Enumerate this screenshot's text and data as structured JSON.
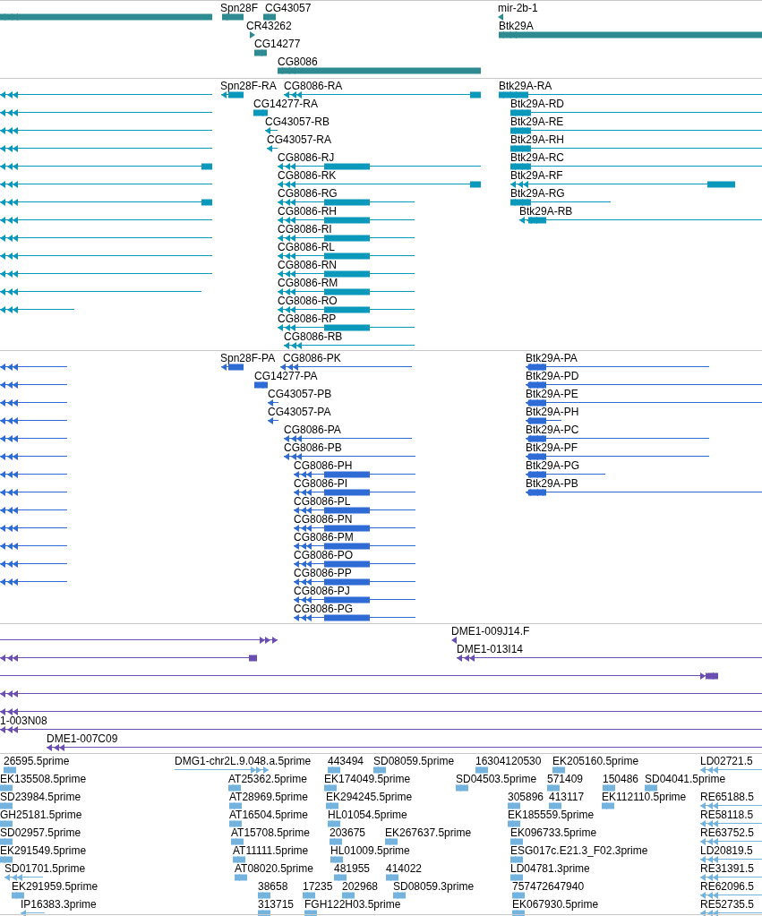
{
  "tracks": [
    {
      "color": "#2d8b91",
      "features": [
        {
          "label": "Spn28F"
        },
        {
          "label": "CG43057"
        },
        {
          "label": "mir-2b-1"
        },
        {
          "label": "CR43262"
        },
        {
          "label": "Btk29A"
        },
        {
          "label": "CG14277"
        },
        {
          "label": "CG8086"
        }
      ]
    },
    {
      "color": "#0a98bb",
      "features": [
        {
          "label": "Spn28F-RA"
        },
        {
          "label": "CG8086-RA"
        },
        {
          "label": "Btk29A-RA"
        },
        {
          "label": "CG14277-RA"
        },
        {
          "label": "Btk29A-RD"
        },
        {
          "label": "CG43057-RB"
        },
        {
          "label": "Btk29A-RE"
        },
        {
          "label": "CG43057-RA"
        },
        {
          "label": "Btk29A-RH"
        },
        {
          "label": "CG8086-RJ"
        },
        {
          "label": "Btk29A-RC"
        },
        {
          "label": "CG8086-RK"
        },
        {
          "label": "Btk29A-RF"
        },
        {
          "label": "CG8086-RG"
        },
        {
          "label": "Btk29A-RG"
        },
        {
          "label": "CG8086-RH"
        },
        {
          "label": "Btk29A-RB"
        },
        {
          "label": "CG8086-RI"
        },
        {
          "label": "CG8086-RL"
        },
        {
          "label": "CG8086-RN"
        },
        {
          "label": "CG8086-RM"
        },
        {
          "label": "CG8086-RO"
        },
        {
          "label": "CG8086-RP"
        },
        {
          "label": "CG8086-RB"
        }
      ]
    },
    {
      "color": "#2e6bd4",
      "features": [
        {
          "label": "Spn28F-PA"
        },
        {
          "label": "CG8086-PK"
        },
        {
          "label": "Btk29A-PA"
        },
        {
          "label": "CG14277-PA"
        },
        {
          "label": "Btk29A-PD"
        },
        {
          "label": "CG43057-PB"
        },
        {
          "label": "Btk29A-PE"
        },
        {
          "label": "CG43057-PA"
        },
        {
          "label": "Btk29A-PH"
        },
        {
          "label": "CG8086-PA"
        },
        {
          "label": "Btk29A-PC"
        },
        {
          "label": "CG8086-PB"
        },
        {
          "label": "Btk29A-PF"
        },
        {
          "label": "CG8086-PH"
        },
        {
          "label": "Btk29A-PG"
        },
        {
          "label": "CG8086-PI"
        },
        {
          "label": "Btk29A-PB"
        },
        {
          "label": "CG8086-PL"
        },
        {
          "label": "CG8086-PN"
        },
        {
          "label": "CG8086-PM"
        },
        {
          "label": "CG8086-PO"
        },
        {
          "label": "CG8086-PP"
        },
        {
          "label": "CG8086-PJ"
        },
        {
          "label": "CG8086-PG"
        }
      ]
    },
    {
      "color": "#6a4fb0",
      "features": [
        {
          "label": "DME1-009J14.F"
        },
        {
          "label": "DME1-013I14"
        },
        {
          "label": "1-003N08"
        },
        {
          "label": "DME1-007C09"
        }
      ]
    },
    {
      "color": "#74b3de",
      "features": [
        {
          "label": "26595.5prime"
        },
        {
          "label": "DMG1-chr2L.9.048.a.5prime"
        },
        {
          "label": "443494"
        },
        {
          "label": "SD08059.5prime"
        },
        {
          "label": "16304120530"
        },
        {
          "label": "EK205160.5prime"
        },
        {
          "label": "LD02721.5"
        },
        {
          "label": "EK135508.5prime"
        },
        {
          "label": "AT25362.5prime"
        },
        {
          "label": "EK174049.5prime"
        },
        {
          "label": "SD04503.5prime"
        },
        {
          "label": "571409"
        },
        {
          "label": "150486"
        },
        {
          "label": "SD04041.5prime"
        },
        {
          "label": "SD23984.5prime"
        },
        {
          "label": "AT28969.5prime"
        },
        {
          "label": "EK294245.5prime"
        },
        {
          "label": "305896"
        },
        {
          "label": "413117"
        },
        {
          "label": "EK112110.5prime"
        },
        {
          "label": "RE65188.5"
        },
        {
          "label": "GH25181.5prime"
        },
        {
          "label": "AT16504.5prime"
        },
        {
          "label": "HL01054.5prime"
        },
        {
          "label": "EK185559.5prime"
        },
        {
          "label": "RE58118.5"
        },
        {
          "label": "SD02957.5prime"
        },
        {
          "label": "AT15708.5prime"
        },
        {
          "label": "203675"
        },
        {
          "label": "EK267637.5prime"
        },
        {
          "label": "EK096733.5prime"
        },
        {
          "label": "RE63752.5"
        },
        {
          "label": "EK291549.5prime"
        },
        {
          "label": "AT11111.5prime"
        },
        {
          "label": "HL01009.5prime"
        },
        {
          "label": "ESG017c.E21.3_F02.3prime"
        },
        {
          "label": "LD20819.5"
        },
        {
          "label": "SD01701.5prime"
        },
        {
          "label": "AT08020.5prime"
        },
        {
          "label": "481955"
        },
        {
          "label": "414022"
        },
        {
          "label": "LD04781.3prime"
        },
        {
          "label": "RE31391.5"
        },
        {
          "label": "EK291959.5prime"
        },
        {
          "label": "38658"
        },
        {
          "label": "17235"
        },
        {
          "label": "202968"
        },
        {
          "label": "SD08059.3prime"
        },
        {
          "label": "757472647940"
        },
        {
          "label": "RE62096.5"
        },
        {
          "label": "IP16383.3prime"
        },
        {
          "label": "313715"
        },
        {
          "label": "FGH122H03.5prime"
        },
        {
          "label": "EK067930.5prime"
        },
        {
          "label": "RE52735.5"
        }
      ]
    }
  ]
}
